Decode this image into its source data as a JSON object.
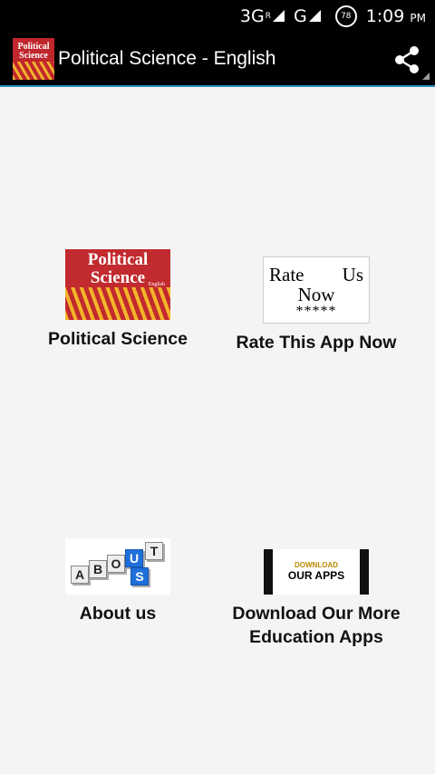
{
  "status_bar": {
    "network_3g": "3G",
    "roaming": "R",
    "network_g": "G",
    "battery": "78",
    "time": "1:09",
    "ampm": "PM"
  },
  "action_bar": {
    "title": "Political Science - English",
    "icon_line1": "Political",
    "icon_line2": "Science"
  },
  "tiles": [
    {
      "label": "Political Science",
      "image_line1": "Political",
      "image_line2": "Science",
      "image_sub": "English"
    },
    {
      "label": "Rate This App Now",
      "image_word1": "Rate",
      "image_word2": "Us",
      "image_word3": "Now",
      "image_stars": "*****"
    },
    {
      "label": "About us",
      "image_letters": [
        "A",
        "B",
        "O",
        "U",
        "T",
        "U",
        "S"
      ]
    },
    {
      "label_line1": "Download Our More",
      "label_line2": "Education Apps",
      "image_small": "DOWNLOAD",
      "image_big": "OUR APPS"
    }
  ],
  "colors": {
    "bar_bg": "#000000",
    "accent_line": "#2a8fc0",
    "page_bg": "#f4f4f4",
    "brand_red": "#c12a2e"
  }
}
